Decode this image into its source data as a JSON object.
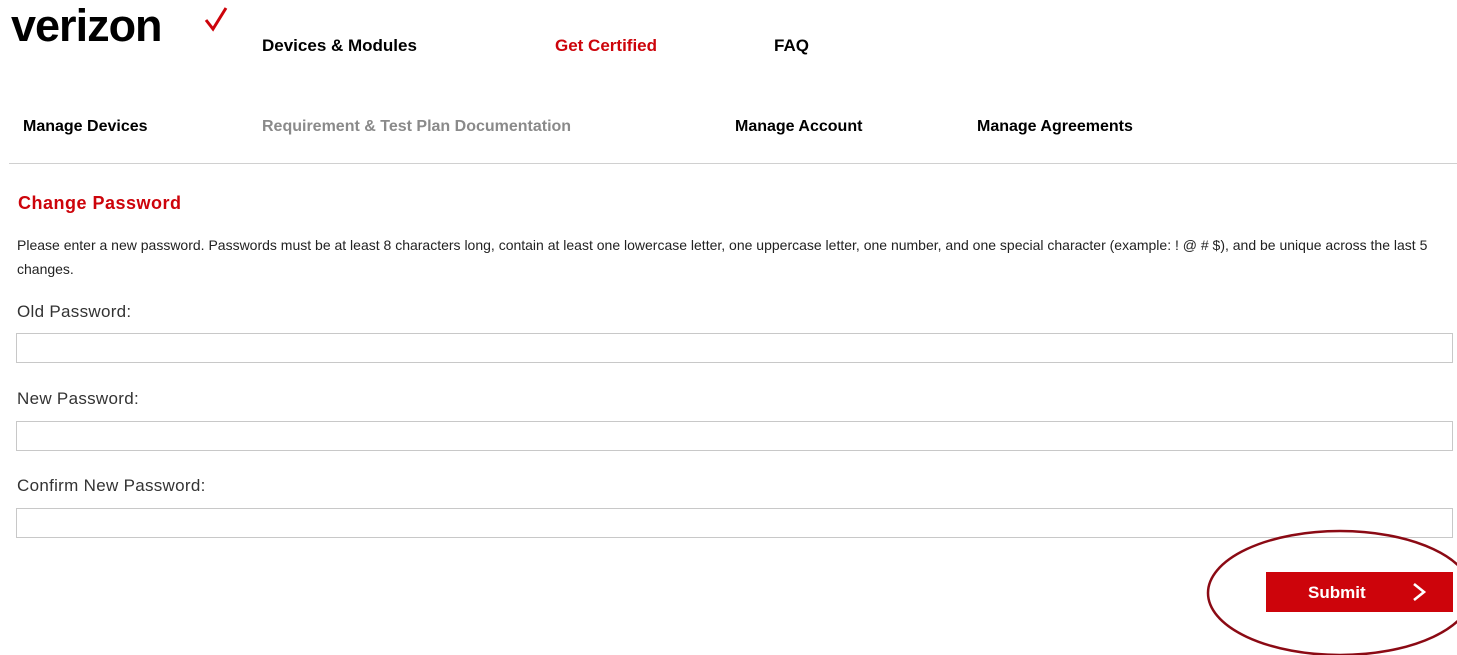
{
  "brand": {
    "logo_text": "verizon",
    "accent_color": "#cd040b"
  },
  "top_nav": {
    "items": [
      {
        "label": "Devices & Modules",
        "active": false
      },
      {
        "label": "Get Certified",
        "active": true
      },
      {
        "label": "FAQ",
        "active": false
      }
    ]
  },
  "sub_nav": {
    "items": [
      {
        "label": "Manage Devices",
        "muted": false
      },
      {
        "label": "Requirement & Test Plan Documentation",
        "muted": true
      },
      {
        "label": "Manage Account",
        "muted": false
      },
      {
        "label": "Manage Agreements",
        "muted": false
      }
    ]
  },
  "page": {
    "title": "Change Password",
    "instructions": "Please enter a new password. Passwords must be at least 8 characters long, contain at least one lowercase letter, one uppercase letter, one number, and one special character (example: ! @ # $), and be unique across the last 5 changes."
  },
  "form": {
    "fields": [
      {
        "label": "Old Password:",
        "value": ""
      },
      {
        "label": "New Password:",
        "value": ""
      },
      {
        "label": "Confirm New Password:",
        "value": ""
      }
    ],
    "submit_label": "Submit",
    "submit_icon": "chevron-right-icon"
  },
  "annotation": {
    "color": "#8b0a14"
  }
}
